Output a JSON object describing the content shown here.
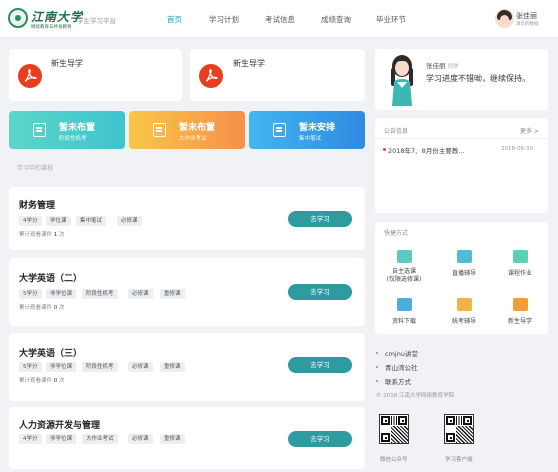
{
  "header": {
    "brand": "江南大学",
    "brand_sub": "继续教育与终身教育",
    "platform": "学生学习平台",
    "nav": [
      "首页",
      "学习计划",
      "考试信息",
      "成绩查询",
      "毕业环节"
    ],
    "user_name": "张佳丽",
    "user_sub": "演示的数据"
  },
  "guides": [
    "新生导学",
    "新生导学"
  ],
  "tiles": [
    {
      "title": "暂未布置",
      "sub": "阶段性机考",
      "color": "#4fd1c5"
    },
    {
      "title": "暂未布置",
      "sub": "大作业考试",
      "color": "#f7a449"
    },
    {
      "title": "暂未安排",
      "sub": "集中笔试",
      "color": "#3ea6ea"
    }
  ],
  "section_label": "学习中的课程",
  "courses": [
    {
      "title": "财务管理",
      "tags": [
        "4学分",
        "学位课",
        "集中笔试",
        "必修课"
      ],
      "progress_label": "累计观看课件",
      "count": "1",
      "unit": "次",
      "button": "去学习"
    },
    {
      "title": "大学英语（二）",
      "tags": [
        "5学分",
        "非学位课",
        "阶段性机考",
        "必修课",
        "重修课"
      ],
      "progress_label": "累计观看课件",
      "count": "0",
      "unit": "次",
      "button": "去学习"
    },
    {
      "title": "大学英语（三）",
      "tags": [
        "5学分",
        "非学位课",
        "阶段性机考",
        "必修课",
        "重修课"
      ],
      "progress_label": "累计观看课件",
      "count": "0",
      "unit": "次",
      "button": "去学习"
    },
    {
      "title": "人力资源开发与管理",
      "tags": [
        "4学分",
        "非学位课",
        "大作业考试",
        "必修课",
        "重修课"
      ],
      "progress_label": "",
      "count": "",
      "unit": "",
      "button": "去学习"
    }
  ],
  "profile": {
    "name": "张佳丽",
    "role": "同学",
    "motto": "学习进度不错呦，继续保持。"
  },
  "notice": {
    "label": "公告信息",
    "more": "更多 >",
    "item": "2018年7、8月份主要教...",
    "date": "2018-06-30"
  },
  "quick": {
    "label": "快捷方式",
    "items": [
      {
        "label": "自主选课\n(仅限选修课)",
        "color": "#5ec9c2"
      },
      {
        "label": "直播辅导",
        "color": "#4fbdd6"
      },
      {
        "label": "课程作业",
        "color": "#5ccfb0"
      },
      {
        "label": "资料下载",
        "color": "#4aaede"
      },
      {
        "label": "统考辅导",
        "color": "#f4b347"
      },
      {
        "label": "新生导学",
        "color": "#f19c3a"
      }
    ]
  },
  "links": [
    "cmjnu讲堂",
    "青山湾公社",
    "联系方式"
  ],
  "copyright": "© 2018 江南大学网络教育学院",
  "qr": [
    "微信公众号",
    "学习客户端"
  ]
}
